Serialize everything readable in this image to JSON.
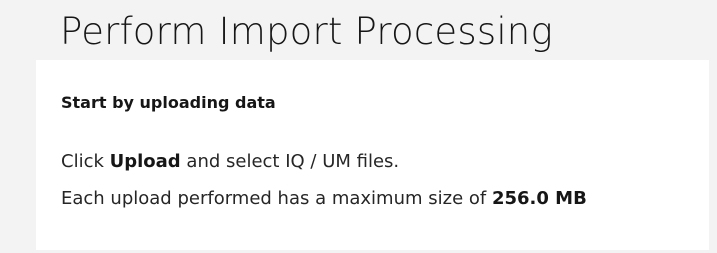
{
  "page": {
    "title": "Perform Import Processing"
  },
  "card": {
    "heading": "Start by uploading data",
    "line1": {
      "prefix": "Click ",
      "emphasis": "Upload",
      "suffix": " and select IQ / UM files."
    },
    "line2": {
      "prefix": "Each upload performed has a maximum size of ",
      "max_size": "256.0 MB"
    }
  },
  "colors": {
    "background": "#f3f3f3",
    "card": "#ffffff",
    "text": "#161616"
  }
}
